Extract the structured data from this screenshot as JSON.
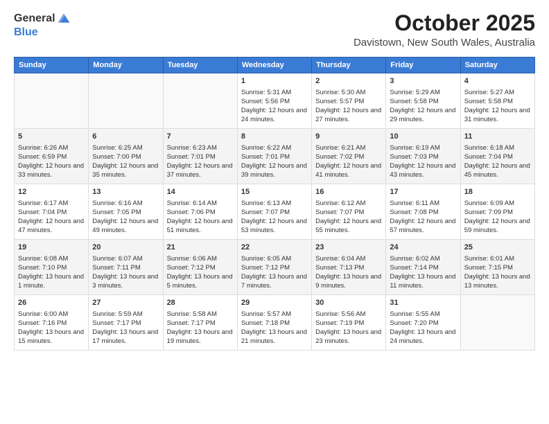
{
  "header": {
    "logo_general": "General",
    "logo_blue": "Blue",
    "month_title": "October 2025",
    "location": "Davistown, New South Wales, Australia"
  },
  "weekdays": [
    "Sunday",
    "Monday",
    "Tuesday",
    "Wednesday",
    "Thursday",
    "Friday",
    "Saturday"
  ],
  "rows": [
    [
      {
        "day": "",
        "sunrise": "",
        "sunset": "",
        "daylight": ""
      },
      {
        "day": "",
        "sunrise": "",
        "sunset": "",
        "daylight": ""
      },
      {
        "day": "",
        "sunrise": "",
        "sunset": "",
        "daylight": ""
      },
      {
        "day": "1",
        "sunrise": "Sunrise: 5:31 AM",
        "sunset": "Sunset: 5:56 PM",
        "daylight": "Daylight: 12 hours and 24 minutes."
      },
      {
        "day": "2",
        "sunrise": "Sunrise: 5:30 AM",
        "sunset": "Sunset: 5:57 PM",
        "daylight": "Daylight: 12 hours and 27 minutes."
      },
      {
        "day": "3",
        "sunrise": "Sunrise: 5:29 AM",
        "sunset": "Sunset: 5:58 PM",
        "daylight": "Daylight: 12 hours and 29 minutes."
      },
      {
        "day": "4",
        "sunrise": "Sunrise: 5:27 AM",
        "sunset": "Sunset: 5:58 PM",
        "daylight": "Daylight: 12 hours and 31 minutes."
      }
    ],
    [
      {
        "day": "5",
        "sunrise": "Sunrise: 6:26 AM",
        "sunset": "Sunset: 6:59 PM",
        "daylight": "Daylight: 12 hours and 33 minutes."
      },
      {
        "day": "6",
        "sunrise": "Sunrise: 6:25 AM",
        "sunset": "Sunset: 7:00 PM",
        "daylight": "Daylight: 12 hours and 35 minutes."
      },
      {
        "day": "7",
        "sunrise": "Sunrise: 6:23 AM",
        "sunset": "Sunset: 7:01 PM",
        "daylight": "Daylight: 12 hours and 37 minutes."
      },
      {
        "day": "8",
        "sunrise": "Sunrise: 6:22 AM",
        "sunset": "Sunset: 7:01 PM",
        "daylight": "Daylight: 12 hours and 39 minutes."
      },
      {
        "day": "9",
        "sunrise": "Sunrise: 6:21 AM",
        "sunset": "Sunset: 7:02 PM",
        "daylight": "Daylight: 12 hours and 41 minutes."
      },
      {
        "day": "10",
        "sunrise": "Sunrise: 6:19 AM",
        "sunset": "Sunset: 7:03 PM",
        "daylight": "Daylight: 12 hours and 43 minutes."
      },
      {
        "day": "11",
        "sunrise": "Sunrise: 6:18 AM",
        "sunset": "Sunset: 7:04 PM",
        "daylight": "Daylight: 12 hours and 45 minutes."
      }
    ],
    [
      {
        "day": "12",
        "sunrise": "Sunrise: 6:17 AM",
        "sunset": "Sunset: 7:04 PM",
        "daylight": "Daylight: 12 hours and 47 minutes."
      },
      {
        "day": "13",
        "sunrise": "Sunrise: 6:16 AM",
        "sunset": "Sunset: 7:05 PM",
        "daylight": "Daylight: 12 hours and 49 minutes."
      },
      {
        "day": "14",
        "sunrise": "Sunrise: 6:14 AM",
        "sunset": "Sunset: 7:06 PM",
        "daylight": "Daylight: 12 hours and 51 minutes."
      },
      {
        "day": "15",
        "sunrise": "Sunrise: 6:13 AM",
        "sunset": "Sunset: 7:07 PM",
        "daylight": "Daylight: 12 hours and 53 minutes."
      },
      {
        "day": "16",
        "sunrise": "Sunrise: 6:12 AM",
        "sunset": "Sunset: 7:07 PM",
        "daylight": "Daylight: 12 hours and 55 minutes."
      },
      {
        "day": "17",
        "sunrise": "Sunrise: 6:11 AM",
        "sunset": "Sunset: 7:08 PM",
        "daylight": "Daylight: 12 hours and 57 minutes."
      },
      {
        "day": "18",
        "sunrise": "Sunrise: 6:09 AM",
        "sunset": "Sunset: 7:09 PM",
        "daylight": "Daylight: 12 hours and 59 minutes."
      }
    ],
    [
      {
        "day": "19",
        "sunrise": "Sunrise: 6:08 AM",
        "sunset": "Sunset: 7:10 PM",
        "daylight": "Daylight: 13 hours and 1 minute."
      },
      {
        "day": "20",
        "sunrise": "Sunrise: 6:07 AM",
        "sunset": "Sunset: 7:11 PM",
        "daylight": "Daylight: 13 hours and 3 minutes."
      },
      {
        "day": "21",
        "sunrise": "Sunrise: 6:06 AM",
        "sunset": "Sunset: 7:12 PM",
        "daylight": "Daylight: 13 hours and 5 minutes."
      },
      {
        "day": "22",
        "sunrise": "Sunrise: 6:05 AM",
        "sunset": "Sunset: 7:12 PM",
        "daylight": "Daylight: 13 hours and 7 minutes."
      },
      {
        "day": "23",
        "sunrise": "Sunrise: 6:04 AM",
        "sunset": "Sunset: 7:13 PM",
        "daylight": "Daylight: 13 hours and 9 minutes."
      },
      {
        "day": "24",
        "sunrise": "Sunrise: 6:02 AM",
        "sunset": "Sunset: 7:14 PM",
        "daylight": "Daylight: 13 hours and 11 minutes."
      },
      {
        "day": "25",
        "sunrise": "Sunrise: 6:01 AM",
        "sunset": "Sunset: 7:15 PM",
        "daylight": "Daylight: 13 hours and 13 minutes."
      }
    ],
    [
      {
        "day": "26",
        "sunrise": "Sunrise: 6:00 AM",
        "sunset": "Sunset: 7:16 PM",
        "daylight": "Daylight: 13 hours and 15 minutes."
      },
      {
        "day": "27",
        "sunrise": "Sunrise: 5:59 AM",
        "sunset": "Sunset: 7:17 PM",
        "daylight": "Daylight: 13 hours and 17 minutes."
      },
      {
        "day": "28",
        "sunrise": "Sunrise: 5:58 AM",
        "sunset": "Sunset: 7:17 PM",
        "daylight": "Daylight: 13 hours and 19 minutes."
      },
      {
        "day": "29",
        "sunrise": "Sunrise: 5:57 AM",
        "sunset": "Sunset: 7:18 PM",
        "daylight": "Daylight: 13 hours and 21 minutes."
      },
      {
        "day": "30",
        "sunrise": "Sunrise: 5:56 AM",
        "sunset": "Sunset: 7:19 PM",
        "daylight": "Daylight: 13 hours and 23 minutes."
      },
      {
        "day": "31",
        "sunrise": "Sunrise: 5:55 AM",
        "sunset": "Sunset: 7:20 PM",
        "daylight": "Daylight: 13 hours and 24 minutes."
      },
      {
        "day": "",
        "sunrise": "",
        "sunset": "",
        "daylight": ""
      }
    ]
  ]
}
